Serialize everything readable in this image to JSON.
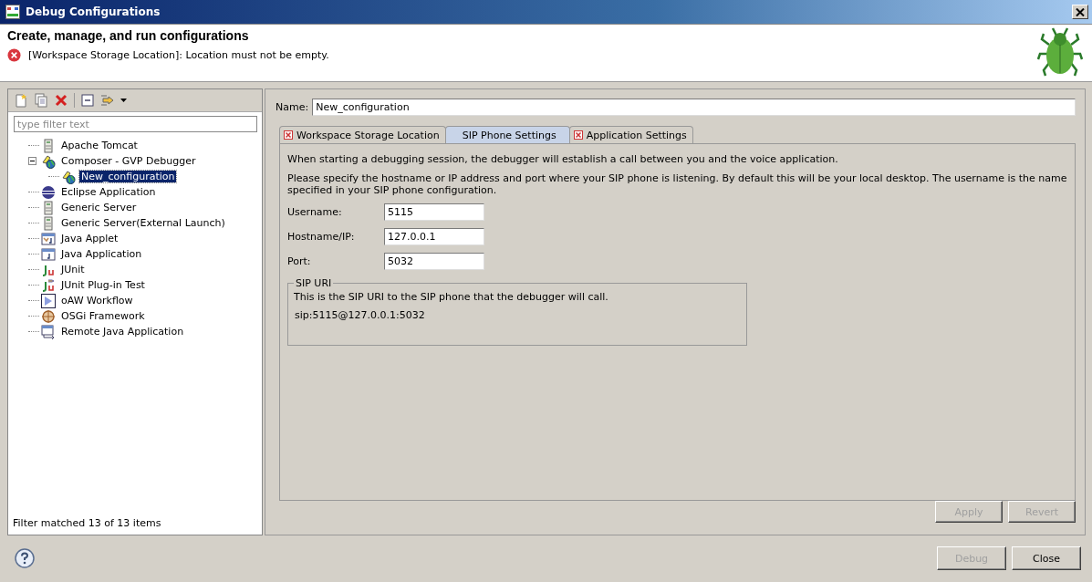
{
  "window": {
    "title": "Debug Configurations"
  },
  "header": {
    "title": "Create, manage, and run configurations",
    "message": "[Workspace Storage Location]: Location must not be empty."
  },
  "filter": {
    "placeholder": "type filter text"
  },
  "tree": [
    {
      "label": "Apache Tomcat",
      "kind": "server",
      "selected": false
    },
    {
      "label": "Composer - GVP Debugger",
      "kind": "composer",
      "selected": false,
      "expanded": true,
      "children": [
        {
          "label": "New_configuration",
          "kind": "composer",
          "selected": true
        }
      ]
    },
    {
      "label": "Eclipse Application",
      "kind": "eclipse",
      "selected": false
    },
    {
      "label": "Generic Server",
      "kind": "server",
      "selected": false
    },
    {
      "label": "Generic Server(External Launch)",
      "kind": "server",
      "selected": false
    },
    {
      "label": "Java Applet",
      "kind": "applet",
      "selected": false
    },
    {
      "label": "Java Application",
      "kind": "javaapp",
      "selected": false
    },
    {
      "label": "JUnit",
      "kind": "junit",
      "selected": false
    },
    {
      "label": "JUnit Plug-in Test",
      "kind": "junitplugin",
      "selected": false
    },
    {
      "label": "oAW Workflow",
      "kind": "workflow",
      "selected": false
    },
    {
      "label": "OSGi Framework",
      "kind": "osgi",
      "selected": false
    },
    {
      "label": "Remote Java Application",
      "kind": "remote",
      "selected": false
    }
  ],
  "filter_status": "Filter matched 13 of 13 items",
  "name": {
    "label": "Name:",
    "value": "New_configuration"
  },
  "tabs": [
    {
      "label": "Workspace Storage Location",
      "error": true,
      "selected": false
    },
    {
      "label": "SIP Phone Settings",
      "error": false,
      "selected": true
    },
    {
      "label": "Application Settings",
      "error": true,
      "selected": false
    }
  ],
  "intro": "When starting a debugging session, the debugger will establish a call between you and the voice application.",
  "instructions": "Please specify the hostname or IP address and port where your SIP phone is listening.  By default this will be your local desktop.  The username is the name specified in your SIP phone configuration.",
  "fields": [
    {
      "label": "Username:",
      "value": "5115"
    },
    {
      "label": "Hostname/IP:",
      "value": "127.0.0.1"
    },
    {
      "label": "Port:",
      "value": "5032"
    }
  ],
  "sip_uri": {
    "title": "SIP URI",
    "description": "This is the SIP URI to the SIP phone that the debugger will call.",
    "value": "sip:5115@127.0.0.1:5032"
  },
  "panel_buttons": [
    {
      "label": "Apply",
      "disabled": true
    },
    {
      "label": "Revert",
      "disabled": true
    }
  ],
  "dialog_buttons": [
    {
      "label": "Debug",
      "disabled": true
    },
    {
      "label": "Close",
      "disabled": false
    }
  ]
}
